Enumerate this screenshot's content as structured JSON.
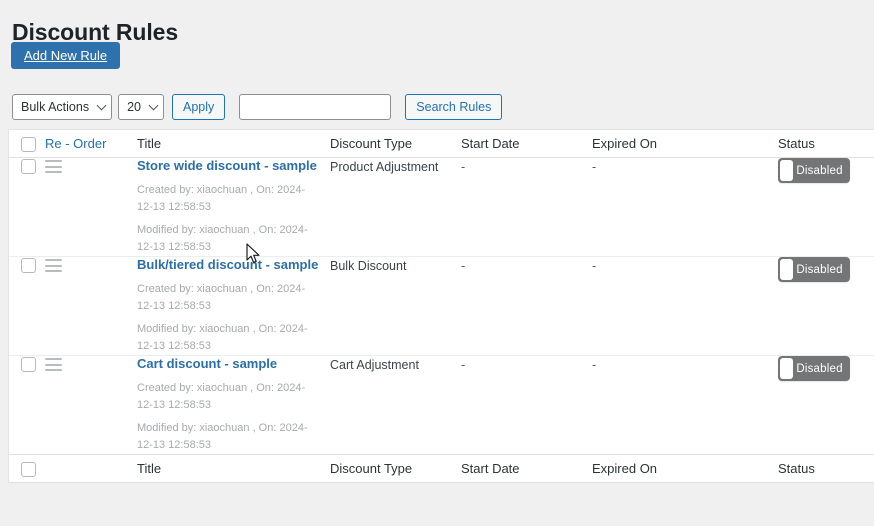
{
  "page": {
    "title": "Discount Rules",
    "add_new_label": "Add New Rule"
  },
  "toolbar": {
    "bulk_actions_label": "Bulk Actions",
    "per_page_value": "20",
    "apply_label": "Apply",
    "search_value": "",
    "search_placeholder": "",
    "search_button_label": "Search Rules"
  },
  "table": {
    "headers": {
      "reorder": "Re - Order",
      "title": "Title",
      "discount_type": "Discount Type",
      "start_date": "Start Date",
      "expired_on": "Expired On",
      "status": "Status"
    },
    "footers": {
      "reorder": "",
      "title": "Title",
      "discount_type": "Discount Type",
      "start_date": "Start Date",
      "expired_on": "Expired On",
      "status": "Status"
    },
    "rows": [
      {
        "title": "Store wide discount - sample",
        "created": "Created by: xiaochuan , On: 2024-12-13 12:58:53",
        "modified": "Modified by: xiaochuan , On: 2024-12-13 12:58:53",
        "discount_type": "Product Adjustment",
        "start_date": "-",
        "expired_on": "-",
        "status": "Disabled"
      },
      {
        "title": "Bulk/tiered discount - sample",
        "created": "Created by: xiaochuan , On: 2024-12-13 12:58:53",
        "modified": "Modified by: xiaochuan , On: 2024-12-13 12:58:53",
        "discount_type": "Bulk Discount",
        "start_date": "-",
        "expired_on": "-",
        "status": "Disabled"
      },
      {
        "title": "Cart discount - sample",
        "created": "Created by: xiaochuan , On: 2024-12-13 12:58:53",
        "modified": "Modified by: xiaochuan , On: 2024-12-13 12:58:53",
        "discount_type": "Cart Adjustment",
        "start_date": "-",
        "expired_on": "-",
        "status": "Disabled"
      }
    ]
  },
  "colors": {
    "accent_blue": "#2e72ad",
    "link_blue": "#2271b1",
    "toggle_off_bg": "#747577",
    "page_bg": "#f0f0f1"
  }
}
